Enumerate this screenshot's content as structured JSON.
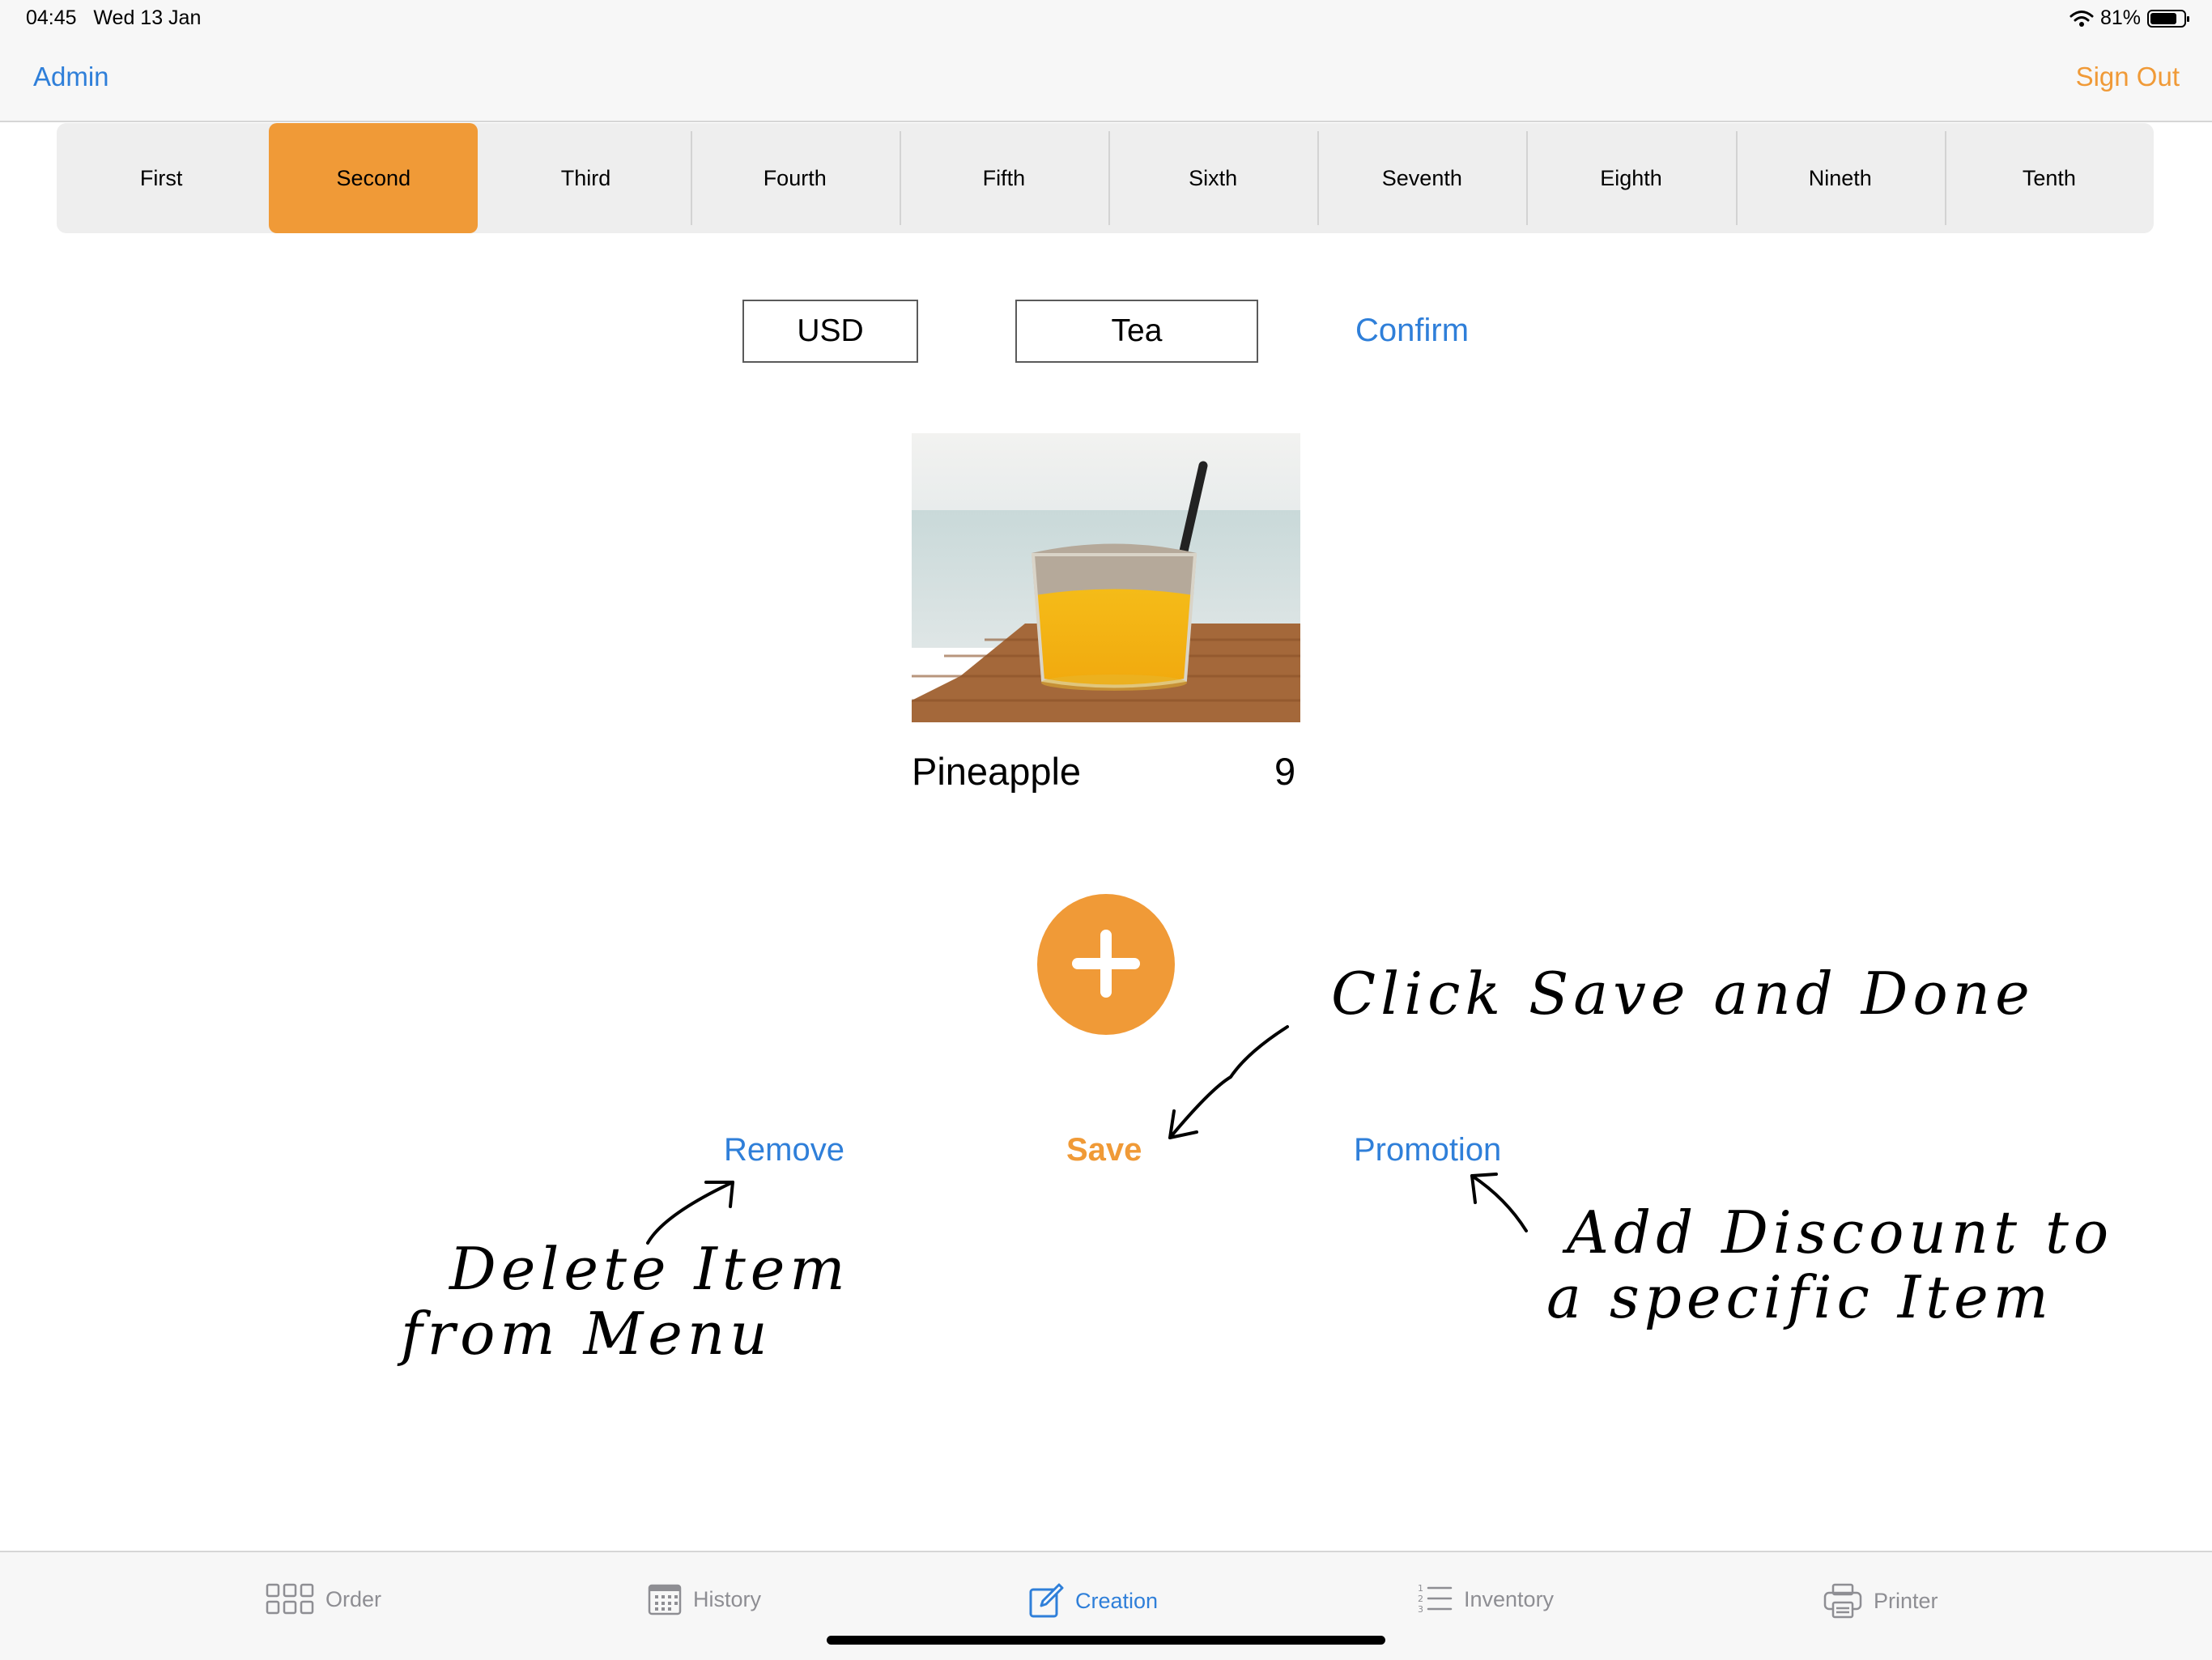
{
  "status": {
    "time": "04:45",
    "date": "Wed 13 Jan",
    "battery": "81%",
    "battery_level": 0.81,
    "wifi_icon": "wifi-icon"
  },
  "nav": {
    "left": "Admin",
    "right": "Sign Out"
  },
  "colors": {
    "accent_orange": "#f09a37",
    "link_blue": "#2f7fd9"
  },
  "segments": {
    "selected": "Second",
    "items": [
      "First",
      "Second",
      "Third",
      "Fourth",
      "Fifth",
      "Sixth",
      "Seventh",
      "Eighth",
      "Nineth",
      "Tenth"
    ]
  },
  "form": {
    "currency": "USD",
    "category": "Tea",
    "confirm": "Confirm"
  },
  "item": {
    "name": "Pineapple",
    "price": "9"
  },
  "actions": {
    "remove": "Remove",
    "save": "Save",
    "promotion": "Promotion"
  },
  "annotations": {
    "save_note": "Click Save and Done",
    "remove_note_line1": "Delete Item",
    "remove_note_line2": "from Menu",
    "promo_note_line1": "Add Discount to",
    "promo_note_line2": "a specific Item"
  },
  "tabs": [
    {
      "label": "Order",
      "icon": "grid-icon",
      "active": false
    },
    {
      "label": "History",
      "icon": "calendar-icon",
      "active": false
    },
    {
      "label": "Creation",
      "icon": "compose-icon",
      "active": true
    },
    {
      "label": "Inventory",
      "icon": "numbered-list-icon",
      "active": false
    },
    {
      "label": "Printer",
      "icon": "printer-icon",
      "active": false
    }
  ]
}
